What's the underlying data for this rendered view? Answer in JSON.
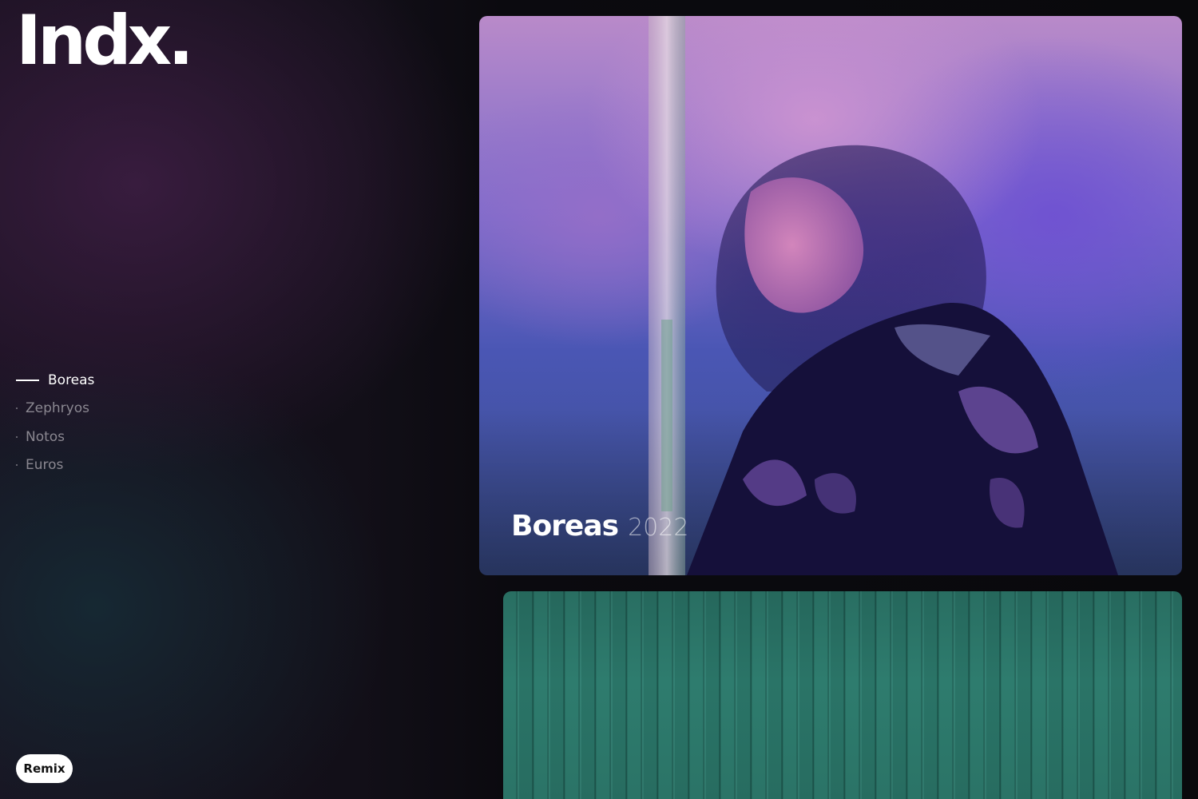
{
  "brand": {
    "logo_text": "Indx."
  },
  "nav": {
    "items": [
      {
        "label": "Boreas",
        "active": true
      },
      {
        "label": "Zephryos",
        "active": false
      },
      {
        "label": "Notos",
        "active": false
      },
      {
        "label": "Euros",
        "active": false
      }
    ]
  },
  "featured": {
    "title": "Boreas",
    "year": "2022"
  },
  "remix": {
    "label": "Remix"
  },
  "colors": {
    "background": "#0b0a0f",
    "text_active": "#ffffff",
    "text_muted": "#8a8790",
    "boreas_tone": "#7d6ccc",
    "zephyros_tone": "#2e7c6e"
  },
  "icons": {
    "active_marker": "horizontal-line",
    "inactive_marker": "dot"
  }
}
